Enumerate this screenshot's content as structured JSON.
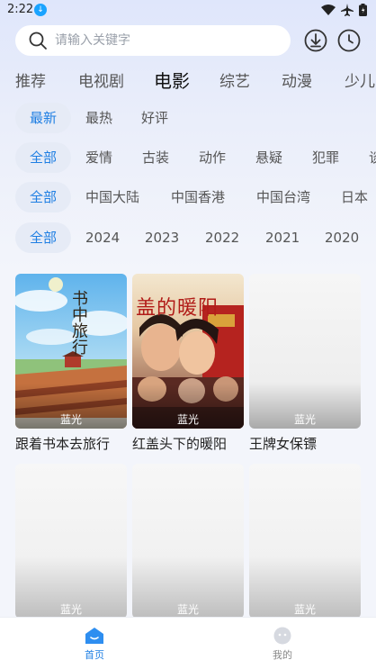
{
  "status_bar": {
    "time": "2:22"
  },
  "search": {
    "placeholder": "请输入关键字"
  },
  "category_tabs": [
    {
      "label": "推荐",
      "active": false
    },
    {
      "label": "电视剧",
      "active": false
    },
    {
      "label": "电影",
      "active": true
    },
    {
      "label": "综艺",
      "active": false
    },
    {
      "label": "动漫",
      "active": false
    },
    {
      "label": "少儿",
      "active": false
    }
  ],
  "filters": {
    "sort": [
      "最新",
      "最热",
      "好评"
    ],
    "genre": [
      "全部",
      "爱情",
      "古装",
      "动作",
      "悬疑",
      "犯罪",
      "谈"
    ],
    "region": [
      "全部",
      "中国大陆",
      "中国香港",
      "中国台湾",
      "日本"
    ],
    "year": [
      "全部",
      "2024",
      "2023",
      "2022",
      "2021",
      "2020"
    ]
  },
  "movies": [
    {
      "title": "跟着书本去旅行",
      "badge": "蓝光",
      "poster_text": "书中旅行"
    },
    {
      "title": "红盖头下的暖阳",
      "badge": "蓝光",
      "poster_text": "盖的暖阳"
    },
    {
      "title": "王牌女保镖",
      "badge": "蓝光"
    },
    {
      "title": "",
      "badge": "蓝光"
    },
    {
      "title": "",
      "badge": "蓝光"
    },
    {
      "title": "",
      "badge": "蓝光"
    }
  ],
  "bottom_nav": [
    {
      "label": "首页",
      "active": true
    },
    {
      "label": "我的",
      "active": false
    }
  ],
  "colors": {
    "accent": "#1f7fe3",
    "background": "#f3f5fb",
    "chip_active_bg": "#e6ebf6"
  }
}
